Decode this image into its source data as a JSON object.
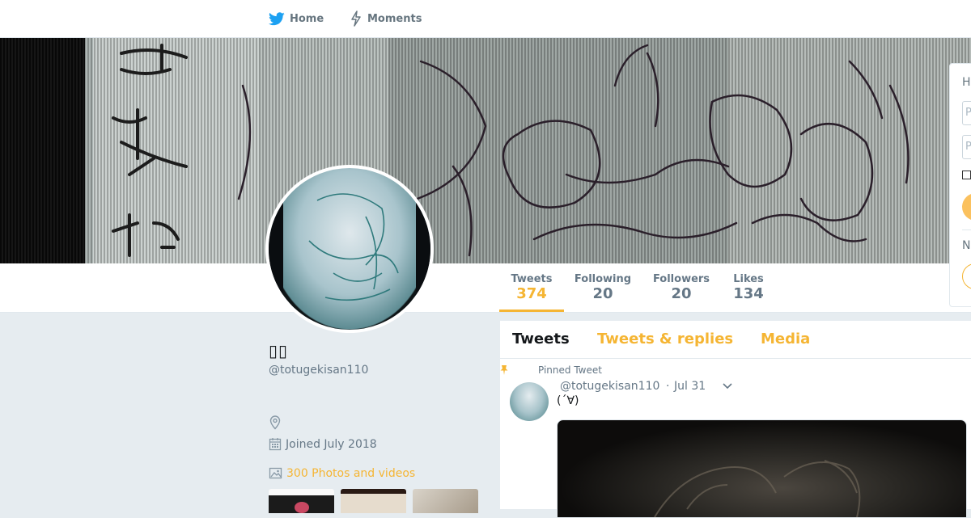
{
  "nav": {
    "home_label": "Home",
    "moments_label": "Moments"
  },
  "stats": {
    "tweets": {
      "label": "Tweets",
      "value": "374"
    },
    "following": {
      "label": "Following",
      "value": "20"
    },
    "followers": {
      "label": "Followers",
      "value": "20"
    },
    "likes": {
      "label": "Likes",
      "value": "134"
    }
  },
  "profile": {
    "display_name": "▯▯",
    "screen_name": "@totugekisan110",
    "joined": "Joined July 2018",
    "photos_videos": "300 Photos and videos"
  },
  "login_card": {
    "heading_fragment": "H",
    "field1_fragment": "P",
    "field2_fragment": "P",
    "new_fragment": "N"
  },
  "timeline": {
    "tabs": [
      "Tweets",
      "Tweets & replies",
      "Media"
    ],
    "active_tab": "Tweets",
    "pinned_label": "Pinned Tweet",
    "tweet": {
      "handle": "@totugekisan110",
      "separator": "·",
      "date": "Jul 31",
      "text": "(´∀)"
    }
  },
  "colors": {
    "accent": "#f5b533",
    "brand_blue": "#1da1f2",
    "page_bg": "#e6ecf0"
  },
  "icons": {
    "home": "twitter-bird-icon",
    "moments": "lightning-icon",
    "location": "location-pin-icon",
    "joined": "calendar-icon",
    "photos": "photo-icon",
    "pinned": "pin-icon",
    "caret": "chevron-down-icon"
  }
}
